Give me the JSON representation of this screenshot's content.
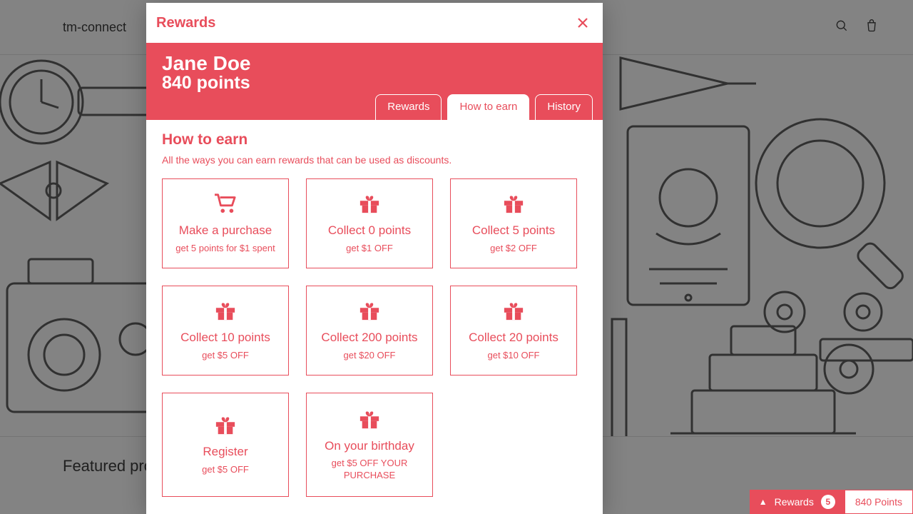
{
  "accent": "#e84d5b",
  "header": {
    "brand": "tm-connect"
  },
  "section_title": "Featured products",
  "modal": {
    "title": "Rewards",
    "user_name": "Jane Doe",
    "points_line": "840 points",
    "tabs": [
      {
        "label": "Rewards",
        "active": false
      },
      {
        "label": "How to earn",
        "active": true
      },
      {
        "label": "History",
        "active": false
      }
    ],
    "body": {
      "title": "How to earn",
      "subtitle": "All the ways you can earn rewards that can be used as discounts.",
      "cards": [
        {
          "icon": "cart",
          "title": "Make a purchase",
          "sub": "get 5 points for $1 spent"
        },
        {
          "icon": "gift",
          "title": "Collect 0 points",
          "sub": "get $1 OFF"
        },
        {
          "icon": "gift",
          "title": "Collect 5 points",
          "sub": "get $2 OFF"
        },
        {
          "icon": "gift",
          "title": "Collect 10 points",
          "sub": "get $5 OFF"
        },
        {
          "icon": "gift",
          "title": "Collect 200 points",
          "sub": "get $20 OFF"
        },
        {
          "icon": "gift",
          "title": "Collect 20 points",
          "sub": "get $10 OFF"
        },
        {
          "icon": "gift",
          "title": "Register",
          "sub": "get $5 OFF"
        },
        {
          "icon": "gift",
          "title": "On your birthday",
          "sub": "get $5 OFF YOUR PURCHASE"
        }
      ]
    }
  },
  "rewards_bar": {
    "label": "Rewards",
    "badge": "5",
    "points": "840 Points"
  }
}
